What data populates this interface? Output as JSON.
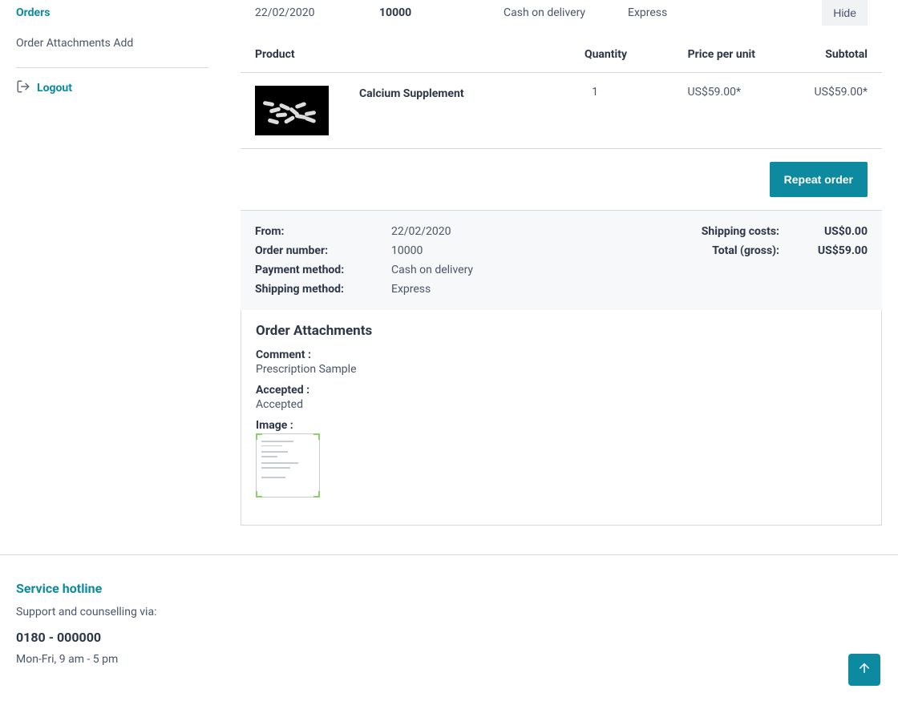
{
  "sidebar": {
    "orders_label": "Orders",
    "attachments_add_label": "Order Attachments Add",
    "logout_label": "Logout"
  },
  "order": {
    "date": "22/02/2020",
    "number": "10000",
    "payment": "Cash on delivery",
    "shipping": "Express",
    "hide_label": "Hide",
    "headers": {
      "product": "Product",
      "quantity": "Quantity",
      "ppu": "Price per unit",
      "subtotal": "Subtotal"
    },
    "line": {
      "name": "Calcium Supplement",
      "qty": "1",
      "ppu": "US$59.00*",
      "subtotal": "US$59.00*"
    },
    "repeat_label": "Repeat order"
  },
  "details": {
    "from_label": "From:",
    "from_value": "22/02/2020",
    "number_label": "Order number:",
    "number_value": "10000",
    "payment_label": "Payment method:",
    "payment_value": "Cash on delivery",
    "shipping_label": "Shipping method:",
    "shipping_value": "Express",
    "shipcost_label": "Shipping costs:",
    "shipcost_value": "US$0.00",
    "total_label": "Total (gross):",
    "total_value": "US$59.00"
  },
  "attachments": {
    "title": "Order Attachments",
    "comment_label": "Comment :",
    "comment_value": "Prescription Sample",
    "accepted_label": "Accepted :",
    "accepted_value": "Accepted",
    "image_label": "Image :"
  },
  "footer": {
    "hotline_title": "Service hotline",
    "support_text": "Support and counselling via:",
    "phone": "0180 - 000000",
    "hours": "Mon-Fri, 9 am - 5 pm"
  }
}
